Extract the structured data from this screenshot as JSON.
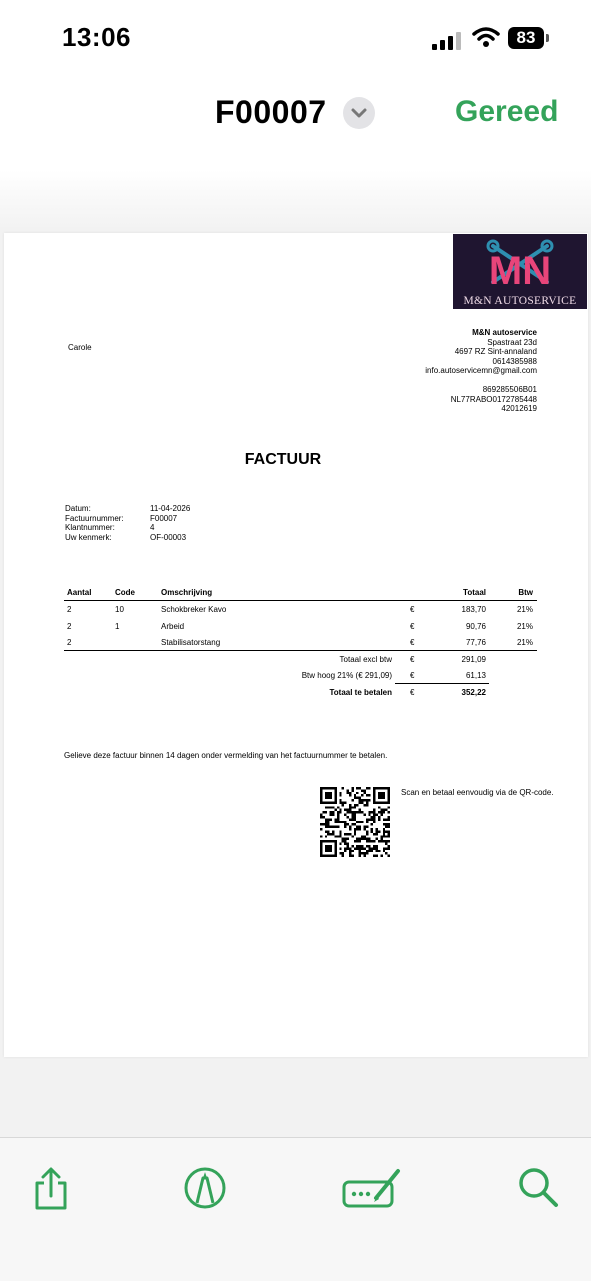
{
  "status_bar": {
    "time": "13:06",
    "battery": "83"
  },
  "nav": {
    "title": "F00007",
    "done_label": "Gereed"
  },
  "invoice": {
    "logo_text": "M&N AUTOSERVICE",
    "logo_monogram": "MN",
    "customer": "Carole",
    "company": {
      "name": "M&N autoservice",
      "street": "Spastraat 23d",
      "city": "4697 RZ Sint-annaland",
      "phone": "0614385988",
      "email": "info.autoservicemn@gmail.com",
      "vat": "869285506B01",
      "iban": "NL77RABO0172785448",
      "kvk": "42012619"
    },
    "heading": "FACTUUR",
    "meta": [
      {
        "label": "Datum:",
        "value": "11-04-2026"
      },
      {
        "label": "Factuurnummer:",
        "value": "F00007"
      },
      {
        "label": "Klantnummer:",
        "value": "4"
      },
      {
        "label": "Uw kenmerk:",
        "value": "OF-00003"
      }
    ],
    "columns": {
      "qty": "Aantal",
      "code": "Code",
      "desc": "Omschrijving",
      "total": "Totaal",
      "vat": "Btw"
    },
    "lines": [
      {
        "qty": "2",
        "code": "10",
        "desc": "Schokbreker Kavo",
        "cur": "€",
        "amount": "183,70",
        "vat": "21%"
      },
      {
        "qty": "2",
        "code": "1",
        "desc": "Arbeid",
        "cur": "€",
        "amount": "90,76",
        "vat": "21%"
      },
      {
        "qty": "2",
        "code": "",
        "desc": "Stabilisatorstang",
        "cur": "€",
        "amount": "77,76",
        "vat": "21%"
      }
    ],
    "totals": [
      {
        "label": "Totaal excl btw",
        "cur": "€",
        "amount": "291,09"
      },
      {
        "label": "Btw hoog 21% (€ 291,09)",
        "cur": "€",
        "amount": "61,13"
      },
      {
        "label": "Totaal te betalen",
        "cur": "€",
        "amount": "352,22"
      }
    ],
    "payment_note": "Gelieve deze factuur binnen 14 dagen onder vermelding van het factuurnummer te betalen.",
    "qr_note": "Scan en betaal eenvoudig via de QR-code."
  },
  "toolbar": {
    "icons": [
      "share-icon",
      "markup-icon",
      "signature-icon",
      "search-icon"
    ],
    "accent": "#34a35a"
  }
}
